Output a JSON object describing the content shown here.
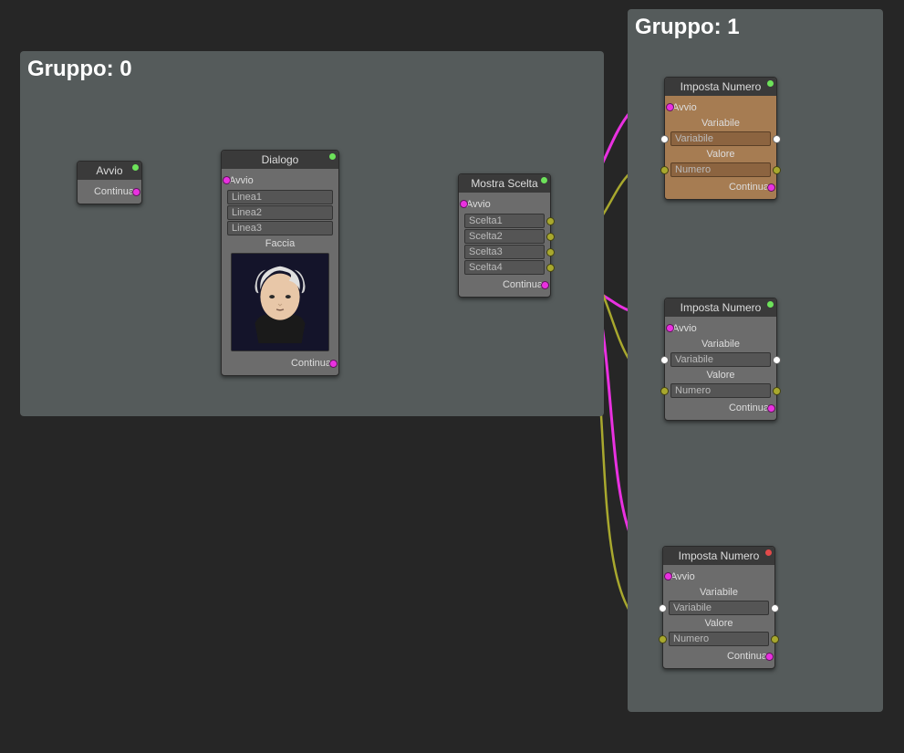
{
  "groups": [
    {
      "title": "Gruppo: 0"
    },
    {
      "title": "Gruppo: 1"
    }
  ],
  "nodes": {
    "avvio": {
      "title": "Avvio",
      "continua": "Continua"
    },
    "dialogo": {
      "title": "Dialogo",
      "avvio": "Avvio",
      "linea1": "Linea1",
      "linea2": "Linea2",
      "linea3": "Linea3",
      "faccia": "Faccia",
      "continua": "Continua"
    },
    "mostra": {
      "title": "Mostra Scelta",
      "avvio": "Avvio",
      "scelta1": "Scelta1",
      "scelta2": "Scelta2",
      "scelta3": "Scelta3",
      "scelta4": "Scelta4",
      "continua": "Continua"
    },
    "imposta1": {
      "title": "Imposta Numero",
      "avvio": "Avvio",
      "variabile_lbl": "Variabile",
      "variabile_field": "Variabile",
      "valore_lbl": "Valore",
      "numero_field": "Numero",
      "continua": "Continua"
    },
    "imposta2": {
      "title": "Imposta Numero",
      "avvio": "Avvio",
      "variabile_lbl": "Variabile",
      "variabile_field": "Variabile",
      "valore_lbl": "Valore",
      "numero_field": "Numero",
      "continua": "Continua"
    },
    "imposta3": {
      "title": "Imposta Numero",
      "avvio": "Avvio",
      "variabile_lbl": "Variabile",
      "variabile_field": "Variabile",
      "valore_lbl": "Valore",
      "numero_field": "Numero",
      "continua": "Continua"
    }
  }
}
